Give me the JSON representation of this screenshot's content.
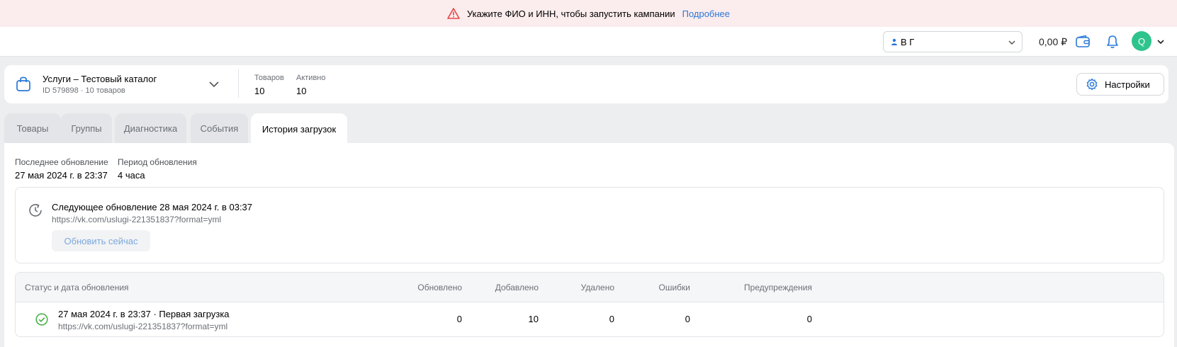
{
  "banner": {
    "text": "Укажите ФИО и ИНН, чтобы запустить кампании",
    "link": "Подробнее"
  },
  "header": {
    "account": "В Г",
    "balance": "0,00 ₽",
    "avatar_letter": "Q",
    "avatar_color": "#2fc48d"
  },
  "catalog": {
    "title": "Услуги – Тестовый каталог",
    "subtitle": "ID 579898 · 10 товаров",
    "stats": [
      {
        "label": "Товаров",
        "value": "10"
      },
      {
        "label": "Активно",
        "value": "10"
      }
    ],
    "settings_label": "Настройки"
  },
  "tabs": [
    {
      "label": "Товары",
      "active": false
    },
    {
      "label": "Группы",
      "active": false
    },
    {
      "label": "Диагностика",
      "active": false
    },
    {
      "label": "События",
      "active": false
    },
    {
      "label": "История загрузок",
      "active": true
    }
  ],
  "update_info": {
    "last_label": "Последнее обновление",
    "last_value": "27 мая 2024 г. в 23:37",
    "period_label": "Период обновления",
    "period_value": "4 часа"
  },
  "next_update": {
    "title": "Следующее обновление 28 мая 2024 г. в 03:37",
    "url": "https://vk.com/uslugi-221351837?format=yml",
    "button": "Обновить сейчас"
  },
  "history": {
    "columns": [
      "Статус и дата обновления",
      "Обновлено",
      "Добавлено",
      "Удалено",
      "Ошибки",
      "Предупреждения"
    ],
    "rows": [
      {
        "title": "27 мая 2024 г. в 23:37 · Первая загрузка",
        "url": "https://vk.com/uslugi-221351837?format=yml",
        "status": "success",
        "updated": "0",
        "added": "10",
        "deleted": "0",
        "errors": "0",
        "warnings": "0"
      }
    ]
  },
  "colors": {
    "accent": "#2a78d8",
    "success": "#4bb34b",
    "warning": "#e64646"
  }
}
